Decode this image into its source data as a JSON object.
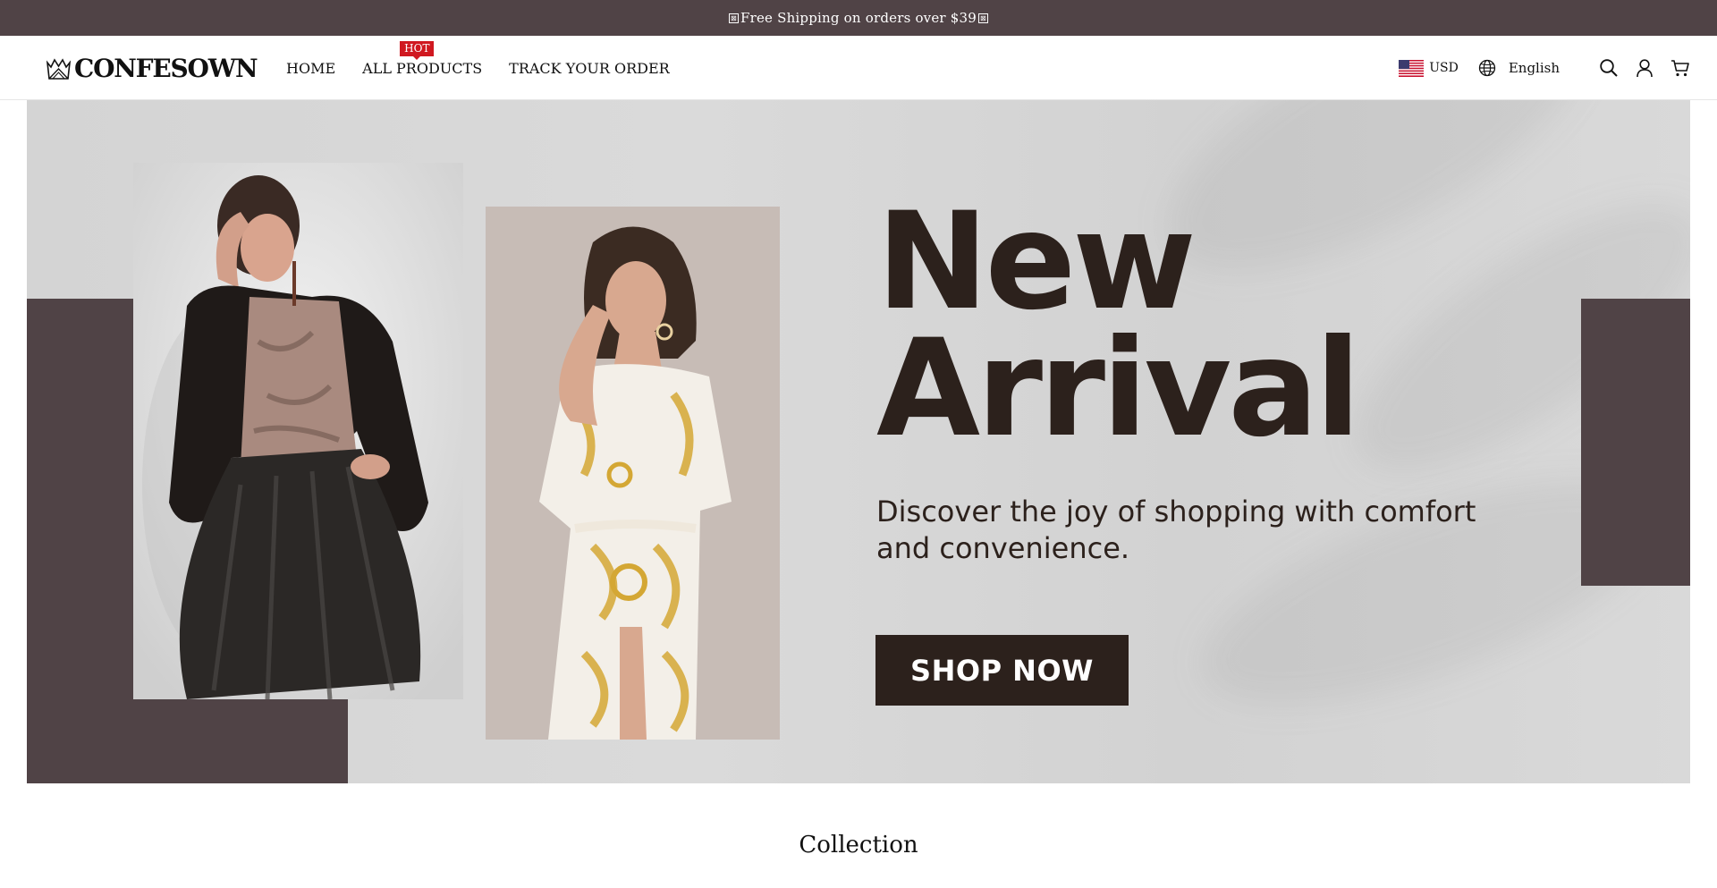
{
  "announcement": {
    "text": "Free Shipping on orders over $39",
    "glyph_left": "⊠",
    "glyph_right": "⊠"
  },
  "brand": {
    "logo_text": "CONFESOWN",
    "logo_icon": "crown-icon"
  },
  "nav": {
    "items": [
      {
        "label": "HOME"
      },
      {
        "label": "ALL PRODUCTS",
        "badge": "HOT"
      },
      {
        "label": "TRACK YOUR ORDER"
      }
    ]
  },
  "utilities": {
    "currency": "USD",
    "currency_icon": "us-flag-icon",
    "language": "English",
    "language_icon": "globe-icon",
    "icons": [
      "search-icon",
      "account-icon",
      "cart-icon"
    ]
  },
  "hero": {
    "headline_line1": "New",
    "headline_line2": "Arrival",
    "subtitle_line1": "Discover the joy of shopping with comfort",
    "subtitle_line2": "and convenience.",
    "cta_label": "SHOP NOW"
  },
  "collection": {
    "title": "Collection"
  },
  "colors": {
    "announcement_bg": "#504346",
    "hero_block": "#504346",
    "hero_text": "#2c211c",
    "hot_badge": "#d01820"
  }
}
